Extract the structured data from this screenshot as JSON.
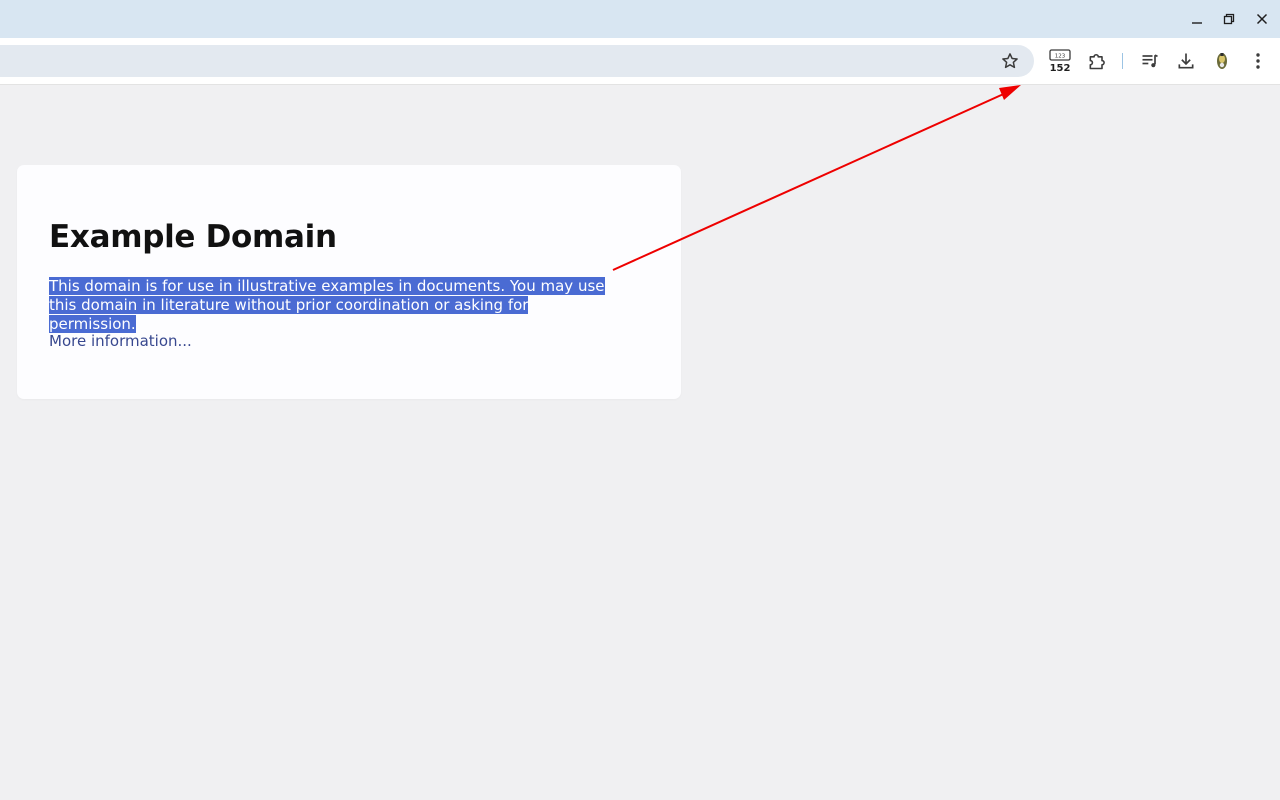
{
  "window": {
    "controls": [
      "minimize-icon",
      "restore-icon",
      "close-icon"
    ]
  },
  "toolbar": {
    "icons": [
      "bookmark-star-icon",
      "counter-badge-icon",
      "extensions-puzzle-icon",
      "media-queue-icon",
      "download-icon",
      "profile-extension-icon",
      "more-menu-icon"
    ],
    "badge_top": "123",
    "badge_count": "152"
  },
  "page": {
    "heading": "Example Domain",
    "description": "This domain is for use in illustrative examples in documents. You may use this domain in literature without prior coordination or asking for permission.",
    "link_text": "More information..."
  },
  "colors": {
    "titlebar": "#d8e6f2",
    "omnibox": "#e3e9f0",
    "page_background": "#f0f0f2",
    "selection": "#4a6bd3",
    "link": "#38488f",
    "annotation_arrow": "#ee0000"
  }
}
